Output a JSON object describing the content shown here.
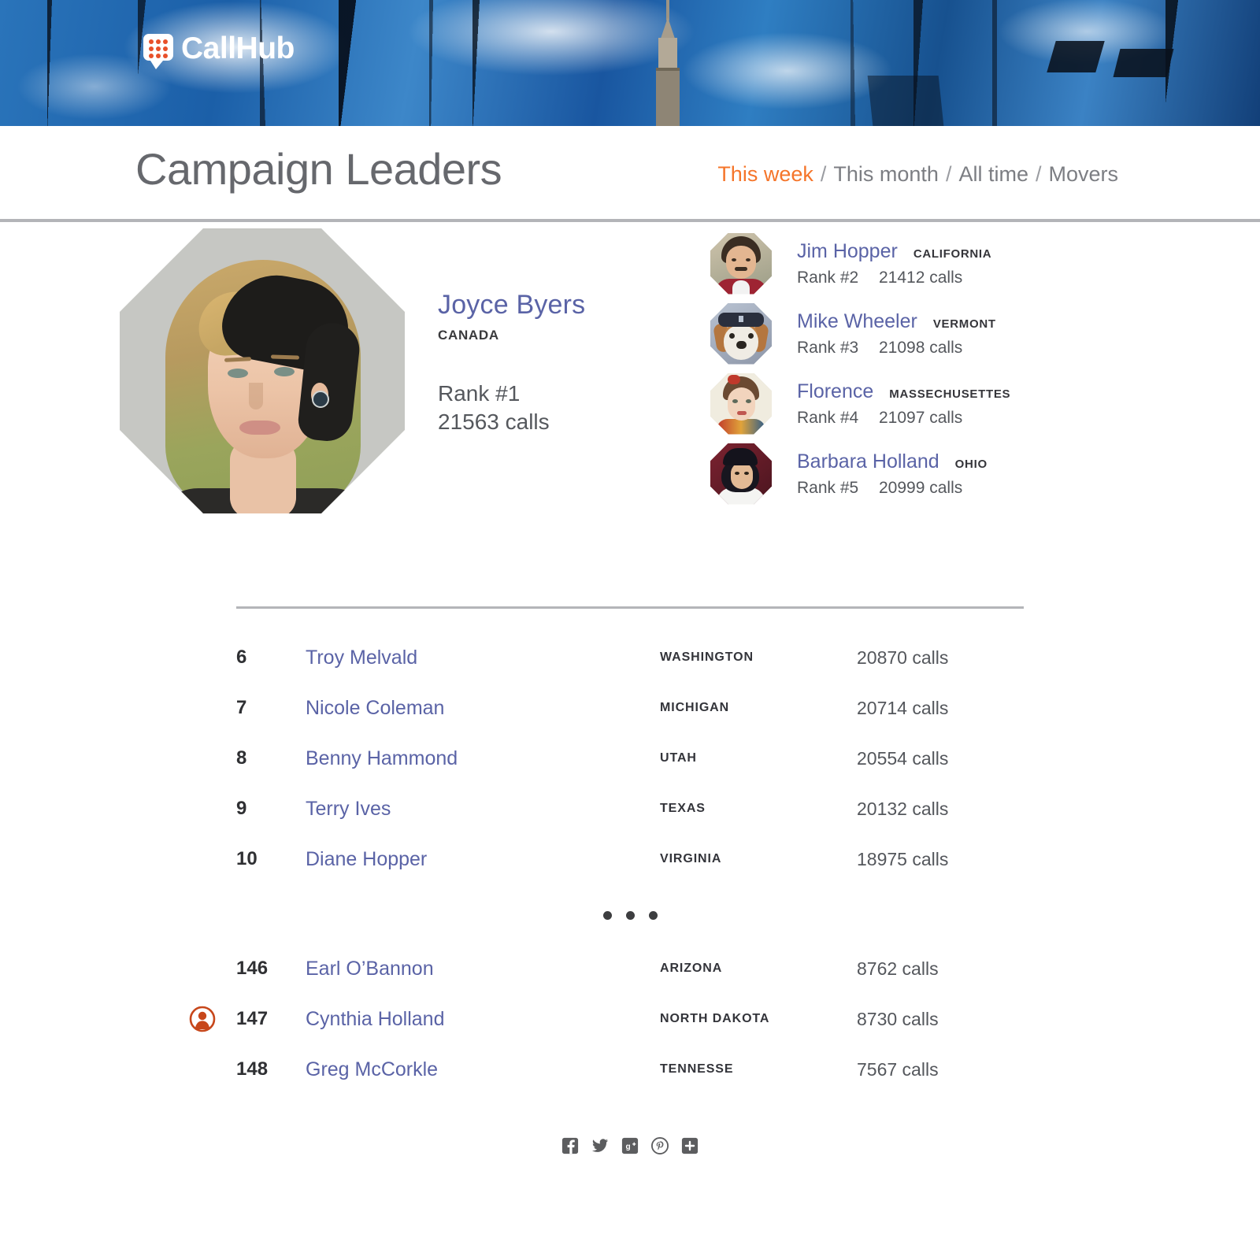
{
  "brand": {
    "name": "CallHub",
    "logo_icon": "callhub-speech-bubble-dots-icon",
    "accent_color": "#e8502a"
  },
  "header": {
    "title": "Campaign Leaders",
    "tabs": [
      {
        "label": "This week",
        "active": true
      },
      {
        "label": "This month",
        "active": false
      },
      {
        "label": "All time",
        "active": false
      },
      {
        "label": "Movers",
        "active": false
      }
    ],
    "separator": "/"
  },
  "leader": {
    "name": "Joyce Byers",
    "region": "CANADA",
    "rank": "Rank #1",
    "calls": "21563 calls",
    "avatar_icon": "leader-portrait-octagon"
  },
  "runners_up": [
    {
      "name": "Jim Hopper",
      "region": "CALIFORNIA",
      "rank": "Rank #2",
      "calls": "21412 calls",
      "avatar_icon": "runner-portrait-octagon"
    },
    {
      "name": "Mike Wheeler",
      "region": "VERMONT",
      "rank": "Rank #3",
      "calls": "21098 calls",
      "avatar_icon": "runner-portrait-octagon"
    },
    {
      "name": "Florence",
      "region": "MASSECHUSETTES",
      "rank": "Rank #4",
      "calls": "21097 calls",
      "avatar_icon": "runner-portrait-octagon"
    },
    {
      "name": "Barbara Holland",
      "region": "OHIO",
      "rank": "Rank #5",
      "calls": "20999 calls",
      "avatar_icon": "runner-portrait-octagon"
    }
  ],
  "table": {
    "rows_top": [
      {
        "rank": "6",
        "name": "Troy Melvald",
        "region": "WASHINGTON",
        "calls": "20870 calls",
        "is_current_user": false
      },
      {
        "rank": "7",
        "name": "Nicole Coleman",
        "region": "MICHIGAN",
        "calls": "20714 calls",
        "is_current_user": false
      },
      {
        "rank": "8",
        "name": "Benny Hammond",
        "region": "UTAH",
        "calls": "20554 calls",
        "is_current_user": false
      },
      {
        "rank": "9",
        "name": "Terry Ives",
        "region": "TEXAS",
        "calls": "20132 calls",
        "is_current_user": false
      },
      {
        "rank": "10",
        "name": "Diane Hopper",
        "region": "VIRGINIA",
        "calls": "18975 calls",
        "is_current_user": false
      }
    ],
    "ellipsis_icon": "three-dots-icon",
    "rows_bottom": [
      {
        "rank": "146",
        "name": "Earl O’Bannon",
        "region": "ARIZONA",
        "calls": "8762 calls",
        "is_current_user": false
      },
      {
        "rank": "147",
        "name": "Cynthia Holland",
        "region": "NORTH  DAKOTA",
        "calls": "8730 calls",
        "is_current_user": true
      },
      {
        "rank": "148",
        "name": "Greg McCorkle",
        "region": "TENNESSE",
        "calls": "7567 calls",
        "is_current_user": false
      }
    ],
    "current_user_icon": "current-user-person-icon",
    "current_user_color": "#c7471b"
  },
  "social": [
    {
      "icon": "facebook-icon"
    },
    {
      "icon": "twitter-icon"
    },
    {
      "icon": "google-plus-icon"
    },
    {
      "icon": "pinterest-icon"
    },
    {
      "icon": "share-plus-icon"
    }
  ],
  "colors": {
    "name_blue": "#5a63a6",
    "tab_active_orange": "#f5752a",
    "body_gray": "#54575c",
    "divider_gray": "#b4b5b9"
  }
}
